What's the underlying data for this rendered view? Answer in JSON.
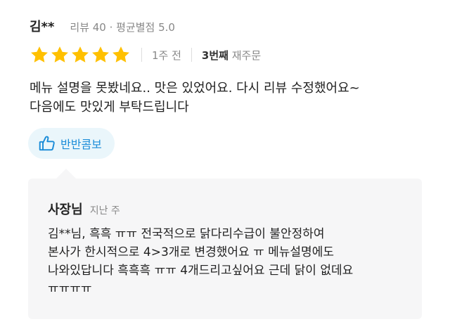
{
  "reviewer": {
    "name": "김**",
    "meta": "리뷰 40 · 평균별점 5.0"
  },
  "rating": {
    "stars": 5,
    "max": 5,
    "star_color": "#ffc000",
    "when": "1주 전",
    "order_count": "3번째",
    "order_suffix": "재주문"
  },
  "review": {
    "lines": [
      "메뉴 설명을 못봤네요.. 맛은 있었어요. 다시 리뷰 수정했어요~",
      "다음에도 맛있게 부탁드립니다"
    ]
  },
  "menu_chip": {
    "icon": "thumbs-up-icon",
    "label": "반반콤보",
    "color": "#1a8cd8"
  },
  "owner_reply": {
    "author": "사장님",
    "time": "지난 주",
    "lines": [
      "김**님, 흑흑 ㅠㅠ 전국적으로 닭다리수급이 불안정하여",
      "본사가 한시적으로 4>3개로 변경했어요 ㅠ 메뉴설명에도",
      "나와있답니다 흑흑흑 ㅠㅠ 4개드리고싶어요 근데 닭이 없데요",
      "ㅠㅠㅠㅠ"
    ]
  }
}
